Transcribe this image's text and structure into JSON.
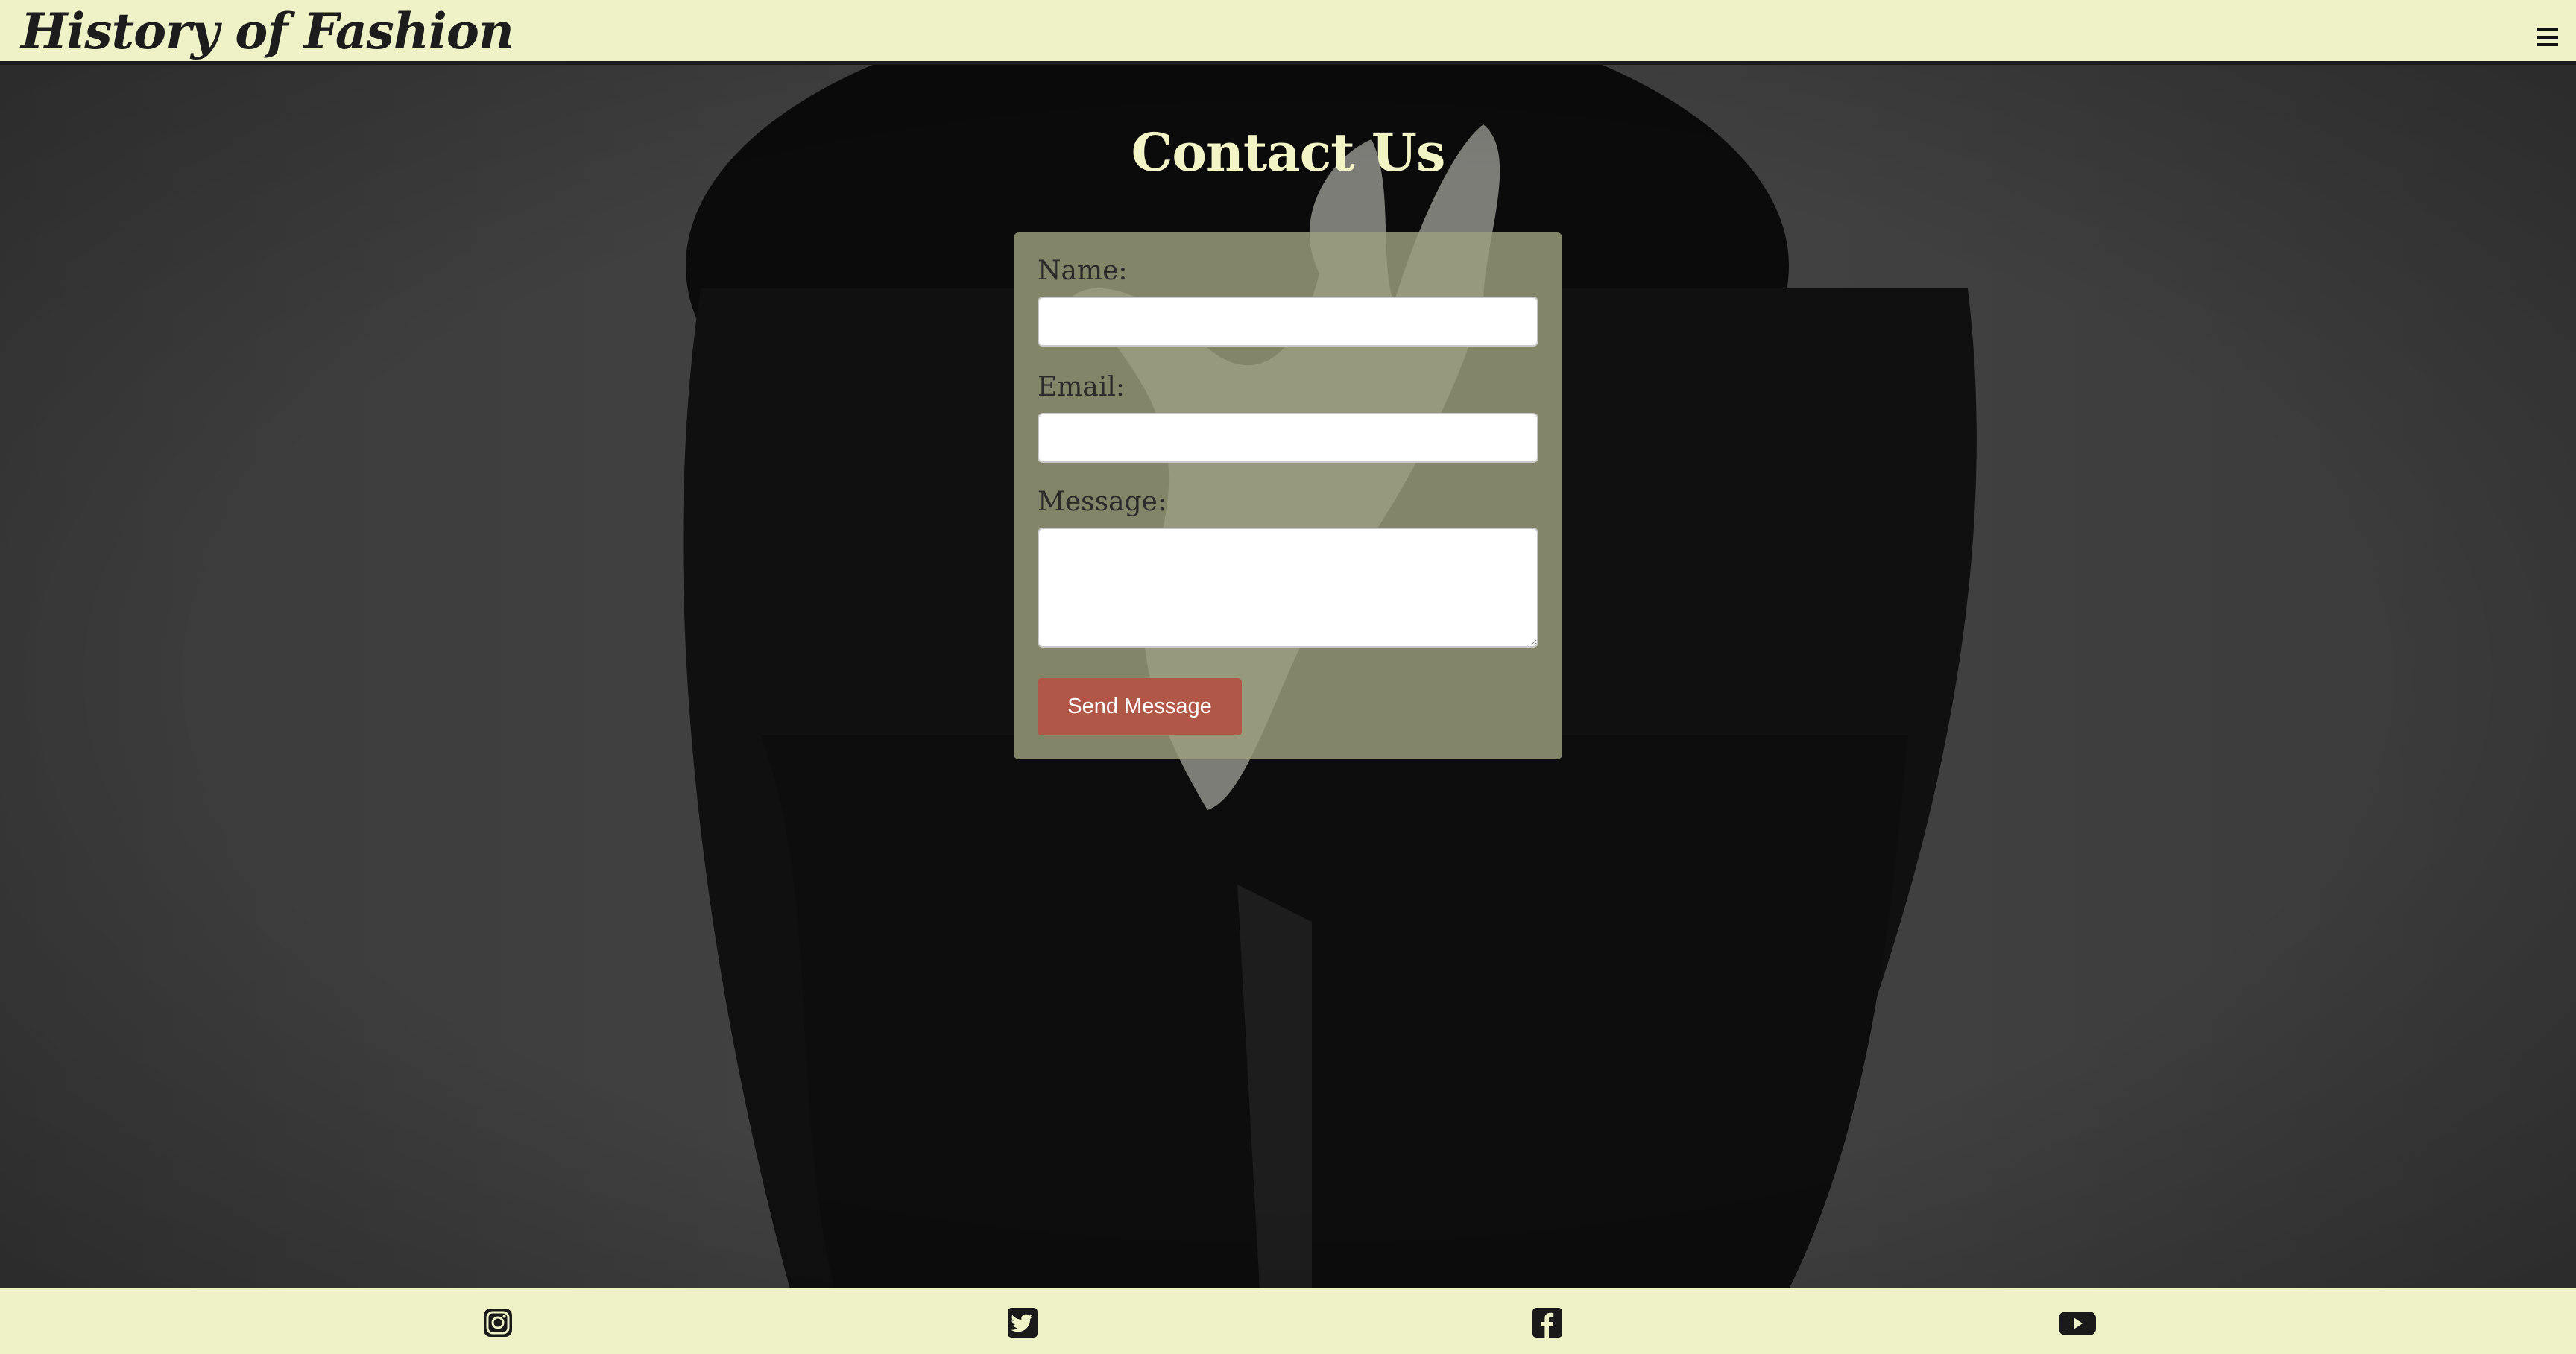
{
  "header": {
    "brand": "History of Fashion",
    "menu_icon": "hamburger-menu-icon"
  },
  "contact": {
    "title": "Contact Us",
    "name_label": "Name:",
    "name_value": "",
    "email_label": "Email:",
    "email_value": "",
    "message_label": "Message:",
    "message_value": "",
    "submit_label": "Send Message"
  },
  "footer": {
    "social": [
      {
        "icon": "instagram-icon"
      },
      {
        "icon": "twitter-icon"
      },
      {
        "icon": "facebook-icon"
      },
      {
        "icon": "youtube-icon"
      }
    ]
  },
  "colors": {
    "header_bg": "#eff2c6",
    "title_text": "#f3f4c6",
    "form_bg": "#9ea07c",
    "button_bg": "#b15748",
    "photo_bg": "#3b3b3b"
  }
}
